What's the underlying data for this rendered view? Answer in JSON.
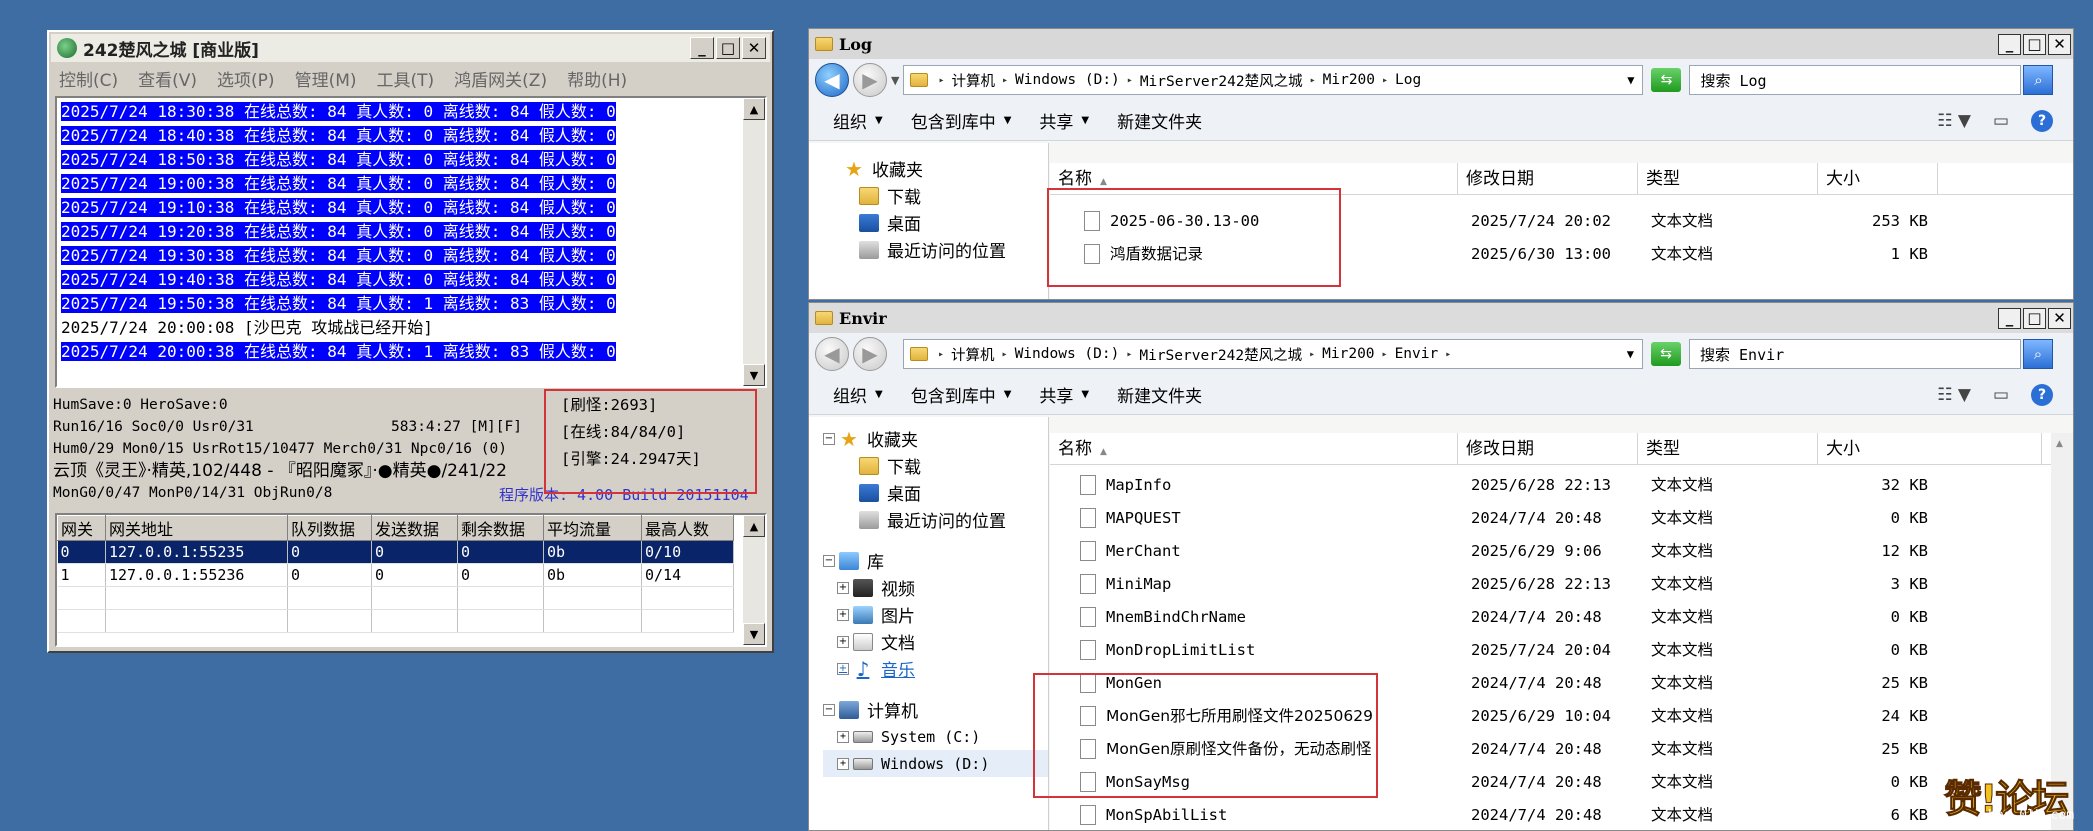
{
  "server": {
    "title": "242楚风之城 [商业版]",
    "menu": [
      "控制(C)",
      "查看(V)",
      "选项(P)",
      "管理(M)",
      "工具(T)",
      "鸿盾网关(Z)",
      "帮助(H)"
    ],
    "log": [
      "2025/7/24 18:30:38 在线总数: 84 真人数: 0 离线数: 84 假人数: 0",
      "2025/7/24 18:40:38 在线总数: 84 真人数: 0 离线数: 84 假人数: 0",
      "2025/7/24 18:50:38 在线总数: 84 真人数: 0 离线数: 84 假人数: 0",
      "2025/7/24 19:00:38 在线总数: 84 真人数: 0 离线数: 84 假人数: 0",
      "2025/7/24 19:10:38 在线总数: 84 真人数: 0 离线数: 84 假人数: 0",
      "2025/7/24 19:20:38 在线总数: 84 真人数: 0 离线数: 84 假人数: 0",
      "2025/7/24 19:30:38 在线总数: 84 真人数: 0 离线数: 84 假人数: 0",
      "2025/7/24 19:40:38 在线总数: 84 真人数: 0 离线数: 84 假人数: 0",
      "2025/7/24 19:50:38 在线总数: 84 真人数: 1 离线数: 83 假人数: 0",
      "2025/7/24 20:00:08 [沙巴克 攻城战已经开始]",
      "2025/7/24 20:00:38 在线总数: 84 真人数: 1 离线数: 83 假人数: 0"
    ],
    "stats": {
      "line1": "HumSave:0 HeroSave:0",
      "line2a": "Run16/16 Soc0/0 Usr0/31",
      "line2b": "583:4:27 [M][F]",
      "line3": "Hum0/29 Mon0/15 UsrRot15/10477 Merch0/31 Npc0/16 (0)",
      "line4": "云顶《灵王》·精英,102/448 - 『昭阳魔冢』·●精英●/241/22",
      "line5": "MonG0/0/47 MonP0/14/31 ObjRun0/8"
    },
    "status": {
      "refresh": "[刷怪:2693]",
      "online": "[在线:84/84/0]",
      "engine": "[引擎:24.2947天]"
    },
    "version": "程序版本: 4.00 Build 20151104",
    "gateway": {
      "headers": [
        "网关",
        "网关地址",
        "队列数据",
        "发送数据",
        "剩余数据",
        "平均流量",
        "最高人数"
      ],
      "rows": [
        [
          "0",
          "127.0.0.1:55235",
          "0",
          "0",
          "0",
          "0b",
          "0/10"
        ],
        [
          "1",
          "127.0.0.1:55236",
          "0",
          "0",
          "0",
          "0b",
          "0/14"
        ]
      ]
    }
  },
  "log_window": {
    "title": "Log",
    "path": [
      "计算机",
      "Windows (D:)",
      "MirServer242楚风之城",
      "Mir200",
      "Log"
    ],
    "search_placeholder": "搜索 Log",
    "toolbar": [
      "组织",
      "包含到库中",
      "共享",
      "新建文件夹"
    ],
    "nav": [
      "收藏夹",
      "下载",
      "桌面",
      "最近访问的位置"
    ],
    "columns": [
      "名称",
      "修改日期",
      "类型",
      "大小"
    ],
    "files": [
      {
        "name": "2025-06-30.13-00",
        "date": "2025/7/24 20:02",
        "type": "文本文档",
        "size": "253 KB"
      },
      {
        "name": "鸿盾数据记录",
        "date": "2025/6/30 13:00",
        "type": "文本文档",
        "size": "1 KB"
      }
    ]
  },
  "envir_window": {
    "title": "Envir",
    "path": [
      "计算机",
      "Windows (D:)",
      "MirServer242楚风之城",
      "Mir200",
      "Envir"
    ],
    "search_placeholder": "搜索 Envir",
    "toolbar": [
      "组织",
      "包含到库中",
      "共享",
      "新建文件夹"
    ],
    "nav": [
      "收藏夹",
      "下载",
      "桌面",
      "最近访问的位置",
      "库",
      "视频",
      "图片",
      "文档",
      "音乐",
      "计算机",
      "System (C:)",
      "Windows (D:)"
    ],
    "columns": [
      "名称",
      "修改日期",
      "类型",
      "大小"
    ],
    "files": [
      {
        "name": "MapInfo",
        "date": "2025/6/28 22:13",
        "type": "文本文档",
        "size": "32 KB"
      },
      {
        "name": "MAPQUEST",
        "date": "2024/7/4 20:48",
        "type": "文本文档",
        "size": "0 KB"
      },
      {
        "name": "MerChant",
        "date": "2025/6/29 9:06",
        "type": "文本文档",
        "size": "12 KB"
      },
      {
        "name": "MiniMap",
        "date": "2025/6/28 22:13",
        "type": "文本文档",
        "size": "3 KB"
      },
      {
        "name": "MnemBindChrName",
        "date": "2024/7/4 20:48",
        "type": "文本文档",
        "size": "0 KB"
      },
      {
        "name": "MonDropLimitList",
        "date": "2025/7/24 20:04",
        "type": "文本文档",
        "size": "0 KB"
      },
      {
        "name": "MonGen",
        "date": "2024/7/4 20:48",
        "type": "文本文档",
        "size": "25 KB"
      },
      {
        "name": "MonGen邪七所用刷怪文件20250629",
        "date": "2025/6/29 10:04",
        "type": "文本文档",
        "size": "24 KB"
      },
      {
        "name": "MonGen原刷怪文件备份，无动态刷怪",
        "date": "2024/7/4 20:48",
        "type": "文本文档",
        "size": "25 KB"
      },
      {
        "name": "MonSayMsg",
        "date": "2024/7/4 20:48",
        "type": "文本文档",
        "size": "0 KB"
      },
      {
        "name": "MonSpAbilList",
        "date": "2024/7/4 20:48",
        "type": "文本文档",
        "size": "6 KB"
      }
    ]
  },
  "watermark": {
    "text": "赞!论坛",
    "url": "bbs.0lb.com"
  },
  "colors": {
    "desktop": "#3d6da3",
    "selection": "#0000ff",
    "highlight_box": "#d3343a"
  }
}
